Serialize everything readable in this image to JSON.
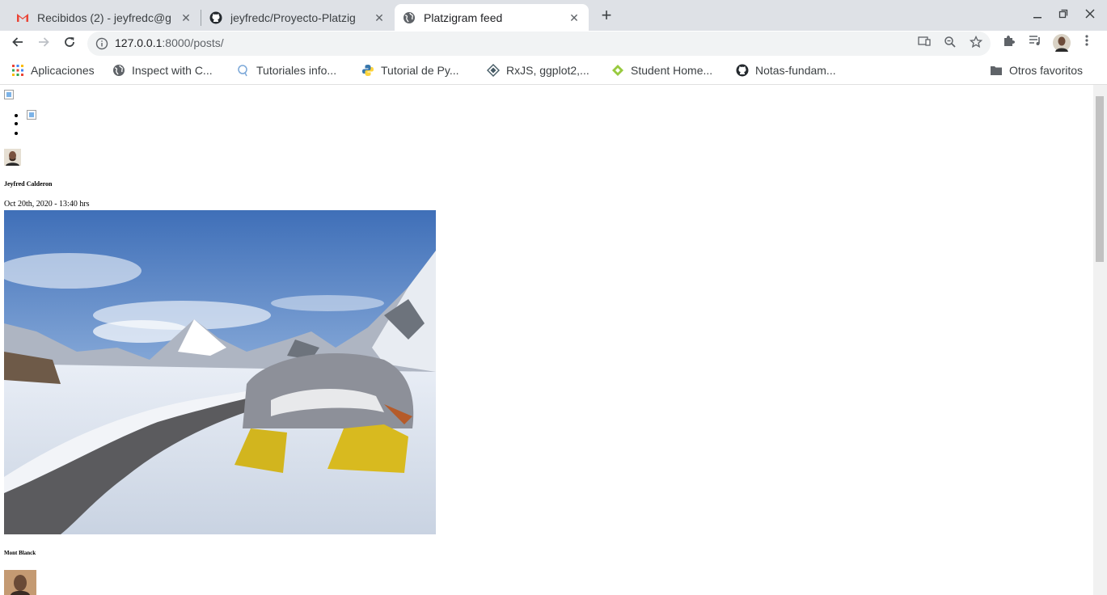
{
  "browser": {
    "tabs": [
      {
        "title": "Recibidos (2) - jeyfredc@g",
        "icon": "gmail-icon"
      },
      {
        "title": "jeyfredc/Proyecto-Platzig",
        "icon": "github-icon"
      },
      {
        "title": "Platzigram feed",
        "icon": "globe-icon"
      }
    ],
    "new_tab_label": "+",
    "url_host": "127.0.0.1",
    "url_rest": ":8000/posts/",
    "bookmarks": [
      {
        "label": "Aplicaciones",
        "icon": "apps-grid-icon"
      },
      {
        "label": "Inspect with C...",
        "icon": "globe-icon"
      },
      {
        "label": "Tutoriales info...",
        "icon": "search-bubble-icon"
      },
      {
        "label": "Tutorial de Py...",
        "icon": "python-icon"
      },
      {
        "label": "RxJS, ggplot2,...",
        "icon": "diamond-icon"
      },
      {
        "label": "Student Home...",
        "icon": "green-diamond-icon"
      },
      {
        "label": "Notas-fundam...",
        "icon": "github-icon"
      }
    ],
    "other_bookmarks": "Otros favoritos",
    "colors": {
      "tabstrip": "#dee1e6",
      "omnibox": "#f1f3f4",
      "gmail_red": "#ea4335"
    }
  },
  "post": {
    "author": "Jeyfred Calderon",
    "date": "Oct 20th, 2020 - 13:40 hrs",
    "caption": "Mont Blanck"
  }
}
